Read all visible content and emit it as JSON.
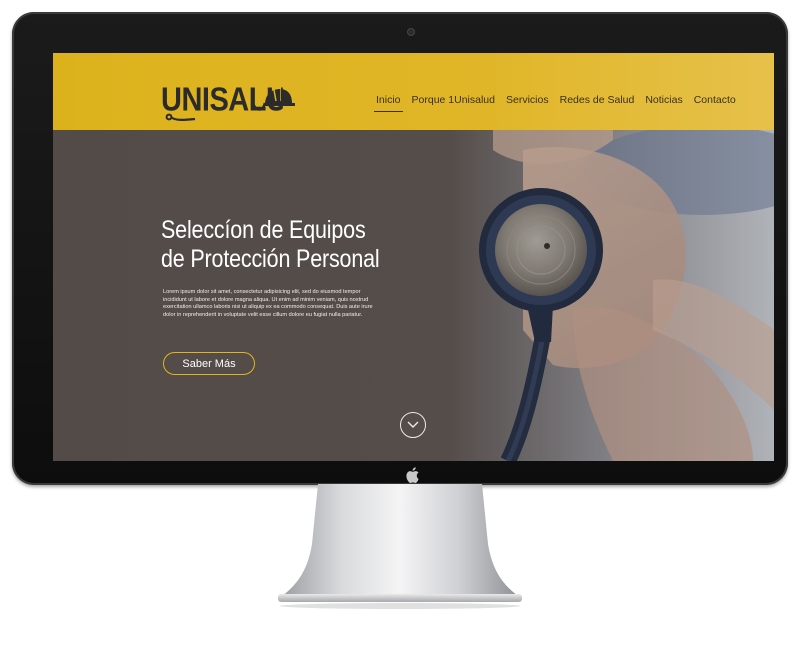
{
  "site": {
    "logo_text": "UNISALUD",
    "brand_color": "#dcb21c"
  },
  "nav": {
    "items": [
      {
        "label": "Inicio",
        "active": true
      },
      {
        "label": "Porque 1Unisalud",
        "active": false
      },
      {
        "label": "Servicios",
        "active": false
      },
      {
        "label": "Redes de Salud",
        "active": false
      },
      {
        "label": "Noticias",
        "active": false
      },
      {
        "label": "Contacto",
        "active": false
      }
    ]
  },
  "hero": {
    "title_line1": "Seleccíon de Equipos",
    "title_line2": "de Protección Personal",
    "body": "Lorem ipsum dolor sit amet, consectetur adipisicing elit, sed do eiusmod tempor incididunt ut labore et dolore magna aliqua. Ut enim ad minim veniam, quis nostrud exercitation ullamco laboris nisi ut aliquip ex ea commodo consequat. Duis aute irure dolor in reprehenderit in voluptate velit esse cillum dolore eu fugiat nulla pariatur.",
    "cta_label": "Saber Más",
    "cta_border_color": "#e2b51f",
    "scroll_icon": "chevron-down-icon"
  },
  "device": {
    "icons": [
      "camera-icon",
      "apple-logo-icon"
    ]
  }
}
